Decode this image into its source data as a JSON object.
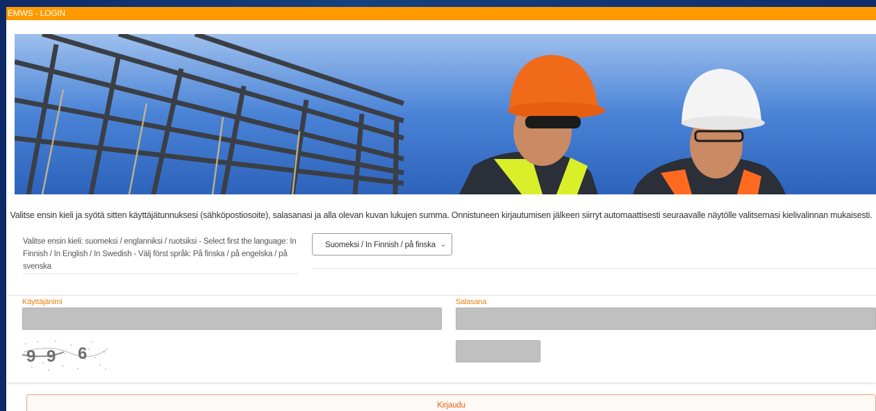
{
  "window": {
    "title": "EMWS - LOGIN"
  },
  "intro_text": "Valitse ensin kieli ja syötä sitten käyttäjätunnuksesi (sähköpostiosoite), salasanasi ja alla olevan kuvan lukujen summa. Onnistuneen kirjautumisen jälkeen siirryt automaattisesti seuraavalle näytölle valitsemasi kielivalinnan mukaisesti.",
  "language": {
    "label": "Valitse ensin kieli: suomeksi / englanniksi / ruotsiksi - Select first the language: In Finnish / In English / In Swedish - Välj först språk: På finska / på engelska / på svenska",
    "selected": "Suomeksi / In Finnish / på finska"
  },
  "form": {
    "username_label": "Käyttäjänimi",
    "username_value": "",
    "password_label": "Salasana",
    "password_value": "",
    "captcha_answer_value": "",
    "captcha_digits": [
      "9",
      "9",
      "6"
    ],
    "login_label": "Kirjaudu"
  },
  "colors": {
    "titlebar": "#ff9900",
    "label_accent": "#e8820c",
    "button_text": "#e8620c"
  },
  "icons": {
    "select_arrow": "chevron-down-icon"
  }
}
